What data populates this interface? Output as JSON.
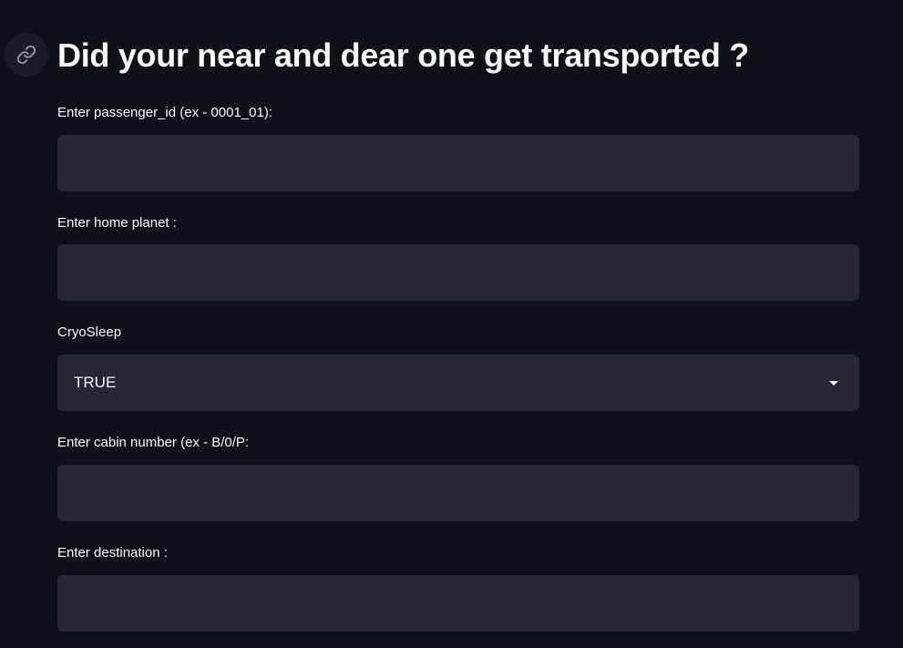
{
  "header": {
    "title": "Did your near and dear one get transported ?",
    "anchor_icon": "link-icon"
  },
  "form": {
    "passenger_id": {
      "label": "Enter passenger_id (ex - 0001_01):",
      "value": "",
      "placeholder": ""
    },
    "home_planet": {
      "label": "Enter home planet :",
      "value": "",
      "placeholder": ""
    },
    "cryo_sleep": {
      "label": "CryoSleep",
      "selected": "TRUE",
      "icon": "chevron-down-icon"
    },
    "cabin_number": {
      "label": "Enter cabin number (ex - B/0/P:",
      "value": "",
      "placeholder": ""
    },
    "destination": {
      "label": "Enter destination :",
      "value": "",
      "placeholder": ""
    }
  },
  "colors": {
    "background": "#0e1117",
    "input_background": "#262730",
    "text": "#fafafa"
  }
}
